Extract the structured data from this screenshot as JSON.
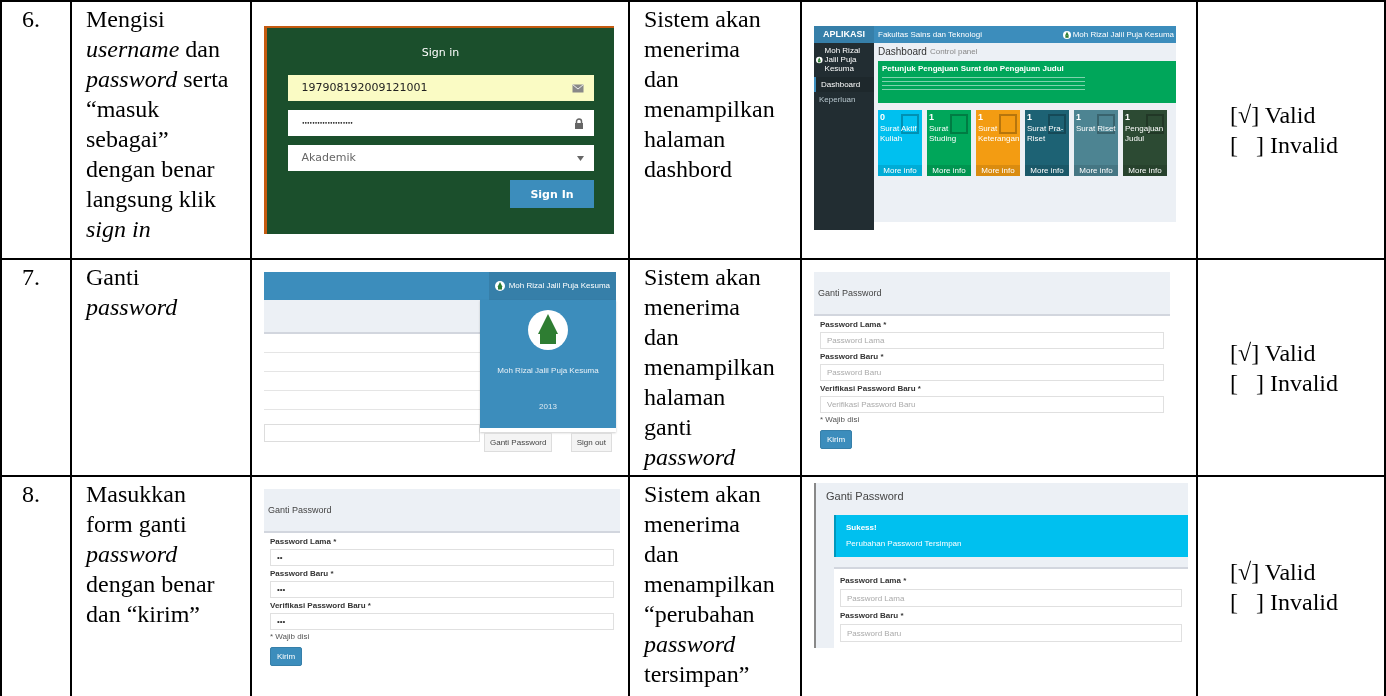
{
  "rows": [
    {
      "number": "6.",
      "step": "Mengisi *username* dan *password* serta “masuk sebagai” dengan benar langsung klik *sign in*",
      "shot_before": {
        "kind": "sign_in",
        "title": "Sign in",
        "username": "197908192009121001",
        "password": "••••••••••••••••••••",
        "role": "Akademik",
        "button": "Sign In"
      },
      "expected": "Sistem akan menerima dan menampilkan halaman dashbord",
      "shot_after": {
        "kind": "dashboard",
        "brand": "APLIKASI",
        "header": "Fakultas Sains dan Teknologi",
        "user": "Moh Rizal Jalil Puja Kesuma",
        "sidebar_user": "Moh Rizal Jalil Puja Kesuma",
        "menu": [
          {
            "label": "Dashboard",
            "selected": true
          },
          {
            "label": "Keperluan",
            "selected": false
          }
        ],
        "page_title": "Dashboard",
        "page_subtitle": "Control panel",
        "notice_title": "Petunjuk Pengajuan Surat dan Pengajuan Judul",
        "cards": [
          {
            "count": "0",
            "label": "Surat Aktif Kuliah",
            "more": "More info",
            "color": "#00c0ef"
          },
          {
            "count": "1",
            "label": "Surat Studing",
            "more": "More info",
            "color": "#00a65a"
          },
          {
            "count": "1",
            "label": "Surat Keterangan",
            "more": "More info",
            "color": "#f39c12"
          },
          {
            "count": "1",
            "label": "Surat Pra-Riset",
            "more": "More info",
            "color": "#1d6274"
          },
          {
            "count": "1",
            "label": "Surat Riset",
            "more": "More info",
            "color": "#4d8492"
          },
          {
            "count": "1",
            "label": "Pengajuan Judul",
            "more": "More info",
            "color": "#2c4a33"
          }
        ]
      },
      "result": [
        "[√] Valid",
        "[   ] Invalid"
      ]
    },
    {
      "number": "7.",
      "step": "Ganti *password*",
      "shot_before": {
        "kind": "user_menu",
        "user": "Moh Rizal Jalil Puja Kesuma",
        "profile_name": "Moh Rizal Jalil Puja Kesuma",
        "profile_year": "2013",
        "buttons": [
          "Ganti Password",
          "Sign out"
        ]
      },
      "expected": "Sistem akan menerima dan menampilkan halaman ganti *password*",
      "shot_after": {
        "kind": "password_form",
        "title": "Ganti Password",
        "fields": [
          {
            "label": "Password Lama *",
            "placeholder": "Password Lama"
          },
          {
            "label": "Password Baru *",
            "placeholder": "Password Baru"
          },
          {
            "label": "Verifikasi Password Baru *",
            "placeholder": "Verifikasi Password Baru"
          }
        ],
        "note": "* Wajib disi",
        "button": "Kirim"
      },
      "result": [
        "[√] Valid",
        "[   ] Invalid"
      ]
    },
    {
      "number": "8.",
      "step": "Masukkan form ganti *password* dengan benar dan “kirim”",
      "shot_before": {
        "kind": "password_form",
        "title": "Ganti Password",
        "fields": [
          {
            "label": "Password Lama *",
            "value": "••"
          },
          {
            "label": "Password Baru *",
            "value": "•••"
          },
          {
            "label": "Verifikasi Password Baru *",
            "value": "•••"
          }
        ],
        "note": "* Wajib disi",
        "button": "Kirim"
      },
      "expected": "Sistem akan menerima dan menampilkan “perubahan *password* tersimpan”",
      "shot_after": {
        "kind": "password_success",
        "title": "Ganti Password",
        "alert_title": "Sukess!",
        "alert_text": "Perubahan Password Tersimpan",
        "fields": [
          {
            "label": "Password Lama *",
            "placeholder": "Password Lama"
          },
          {
            "label": "Password Baru *",
            "placeholder": "Password Baru"
          }
        ]
      },
      "result": [
        "[√] Valid",
        "[   ] Invalid"
      ]
    }
  ]
}
